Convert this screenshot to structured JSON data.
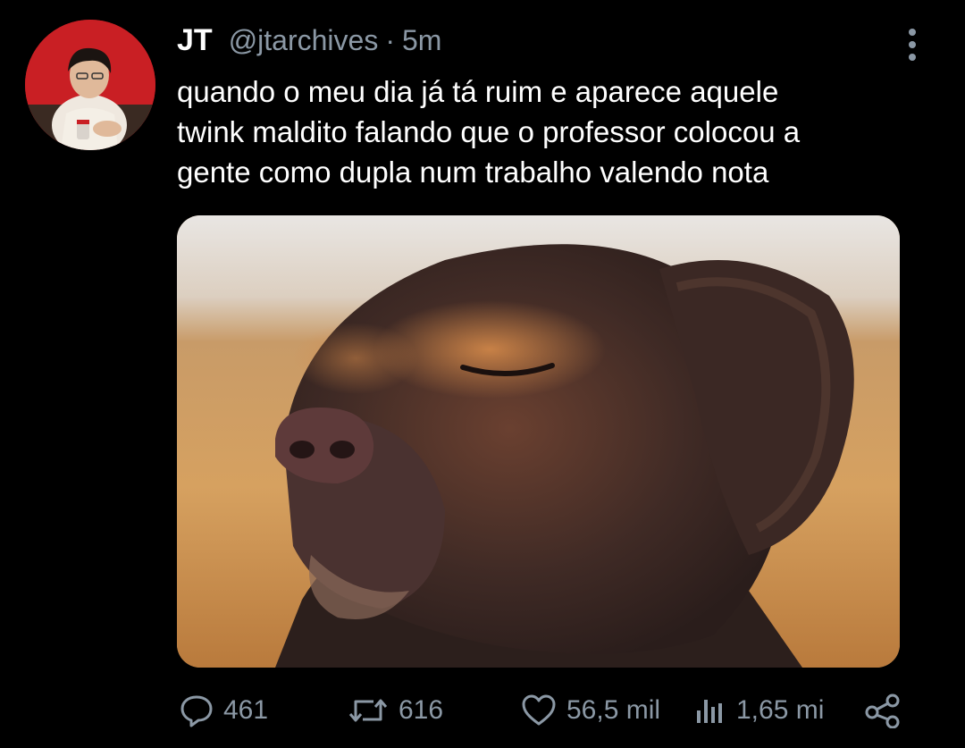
{
  "tweet": {
    "display_name": "JT",
    "handle": "@jtarchives",
    "separator": "·",
    "time": "5m",
    "text": "quando o meu dia já tá ruim e aparece aquele\ntwink maldito falando que o professor colocou a\ngente como dupla num trabalho valendo nota"
  },
  "avatar": {
    "icon": "profile-photo",
    "bg_color": "#c91f24"
  },
  "media": {
    "icon": "dog-photo"
  },
  "actions": {
    "replies": "461",
    "retweets": "616",
    "likes": "56,5 mil",
    "views": "1,65 mi"
  },
  "colors": {
    "background": "#000000",
    "text": "#ffffff",
    "secondary": "#8b98a5"
  }
}
